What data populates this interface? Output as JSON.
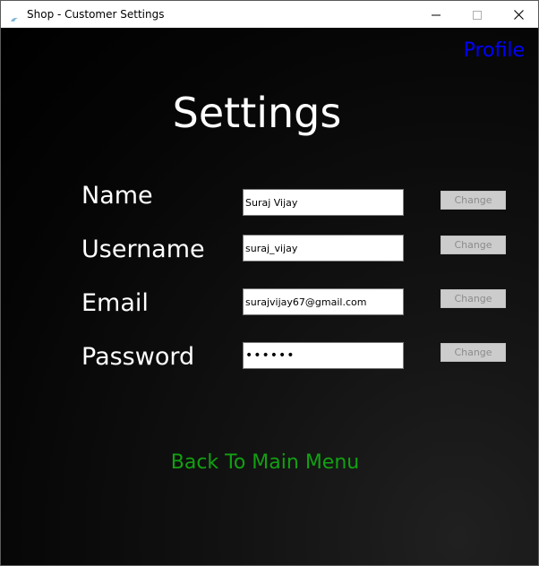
{
  "window": {
    "title": "Shop - Customer Settings",
    "icon": "app-icon"
  },
  "header": {
    "profile_link": "Profile",
    "heading": "Settings"
  },
  "fields": [
    {
      "label": "Name",
      "value": "Suraj Vijay",
      "button": "Change"
    },
    {
      "label": "Username",
      "value": "suraj_vijay",
      "button": "Change"
    },
    {
      "label": "Email",
      "value": "surajvijay67@gmail.com",
      "button": "Change"
    },
    {
      "label": "Password",
      "value": "••••••",
      "button": "Change"
    }
  ],
  "footer": {
    "back_link": "Back To Main Menu"
  },
  "colors": {
    "profile_link": "#0000ff",
    "back_link": "#12a012",
    "background": "#000000",
    "disabled_button": "#cccccc"
  }
}
